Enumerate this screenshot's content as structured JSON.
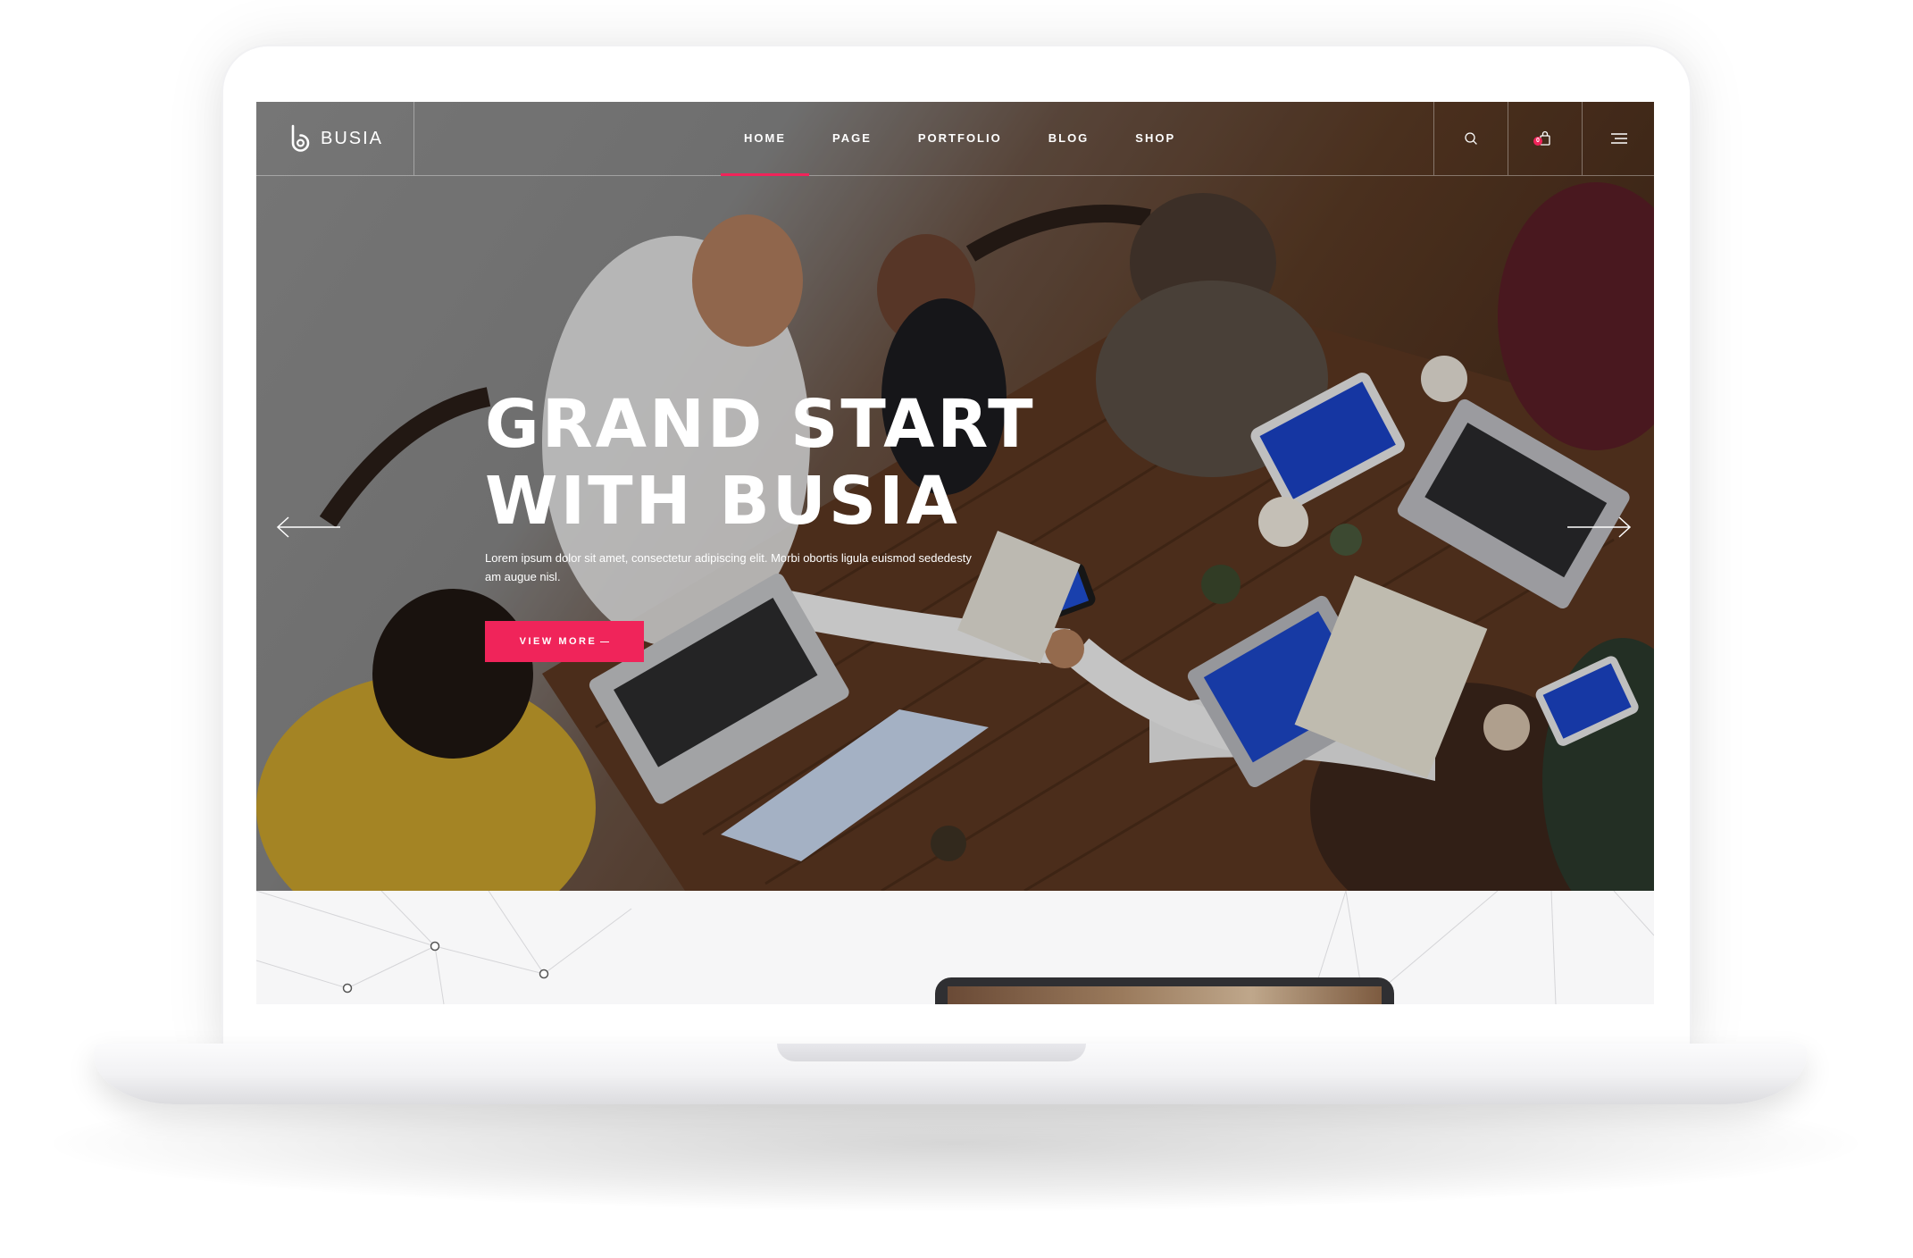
{
  "brand": {
    "name": "BUSIA"
  },
  "nav": {
    "items": [
      {
        "label": "HOME",
        "active": true
      },
      {
        "label": "PAGE",
        "active": false
      },
      {
        "label": "PORTFOLIO",
        "active": false
      },
      {
        "label": "BLOG",
        "active": false
      },
      {
        "label": "SHOP",
        "active": false
      }
    ]
  },
  "header_actions": {
    "search_icon": "search-icon",
    "cart_icon": "cart-icon",
    "cart_count": "0",
    "menu_icon": "hamburger-menu-icon"
  },
  "hero": {
    "title_line1": "GRAND START",
    "title_line2": "WITH BUSIA",
    "text": "Lorem ipsum dolor sit amet, consectetur adipiscing elit. Morbi obortis ligula euismod sededesty am augue nisl.",
    "cta_label": "VIEW MORE",
    "prev_icon": "arrow-left-icon",
    "next_icon": "arrow-right-icon",
    "background": "photo of team meeting around a wooden table with laptops"
  },
  "colors": {
    "accent": "#f0245a",
    "text_on_hero": "#ffffff"
  }
}
